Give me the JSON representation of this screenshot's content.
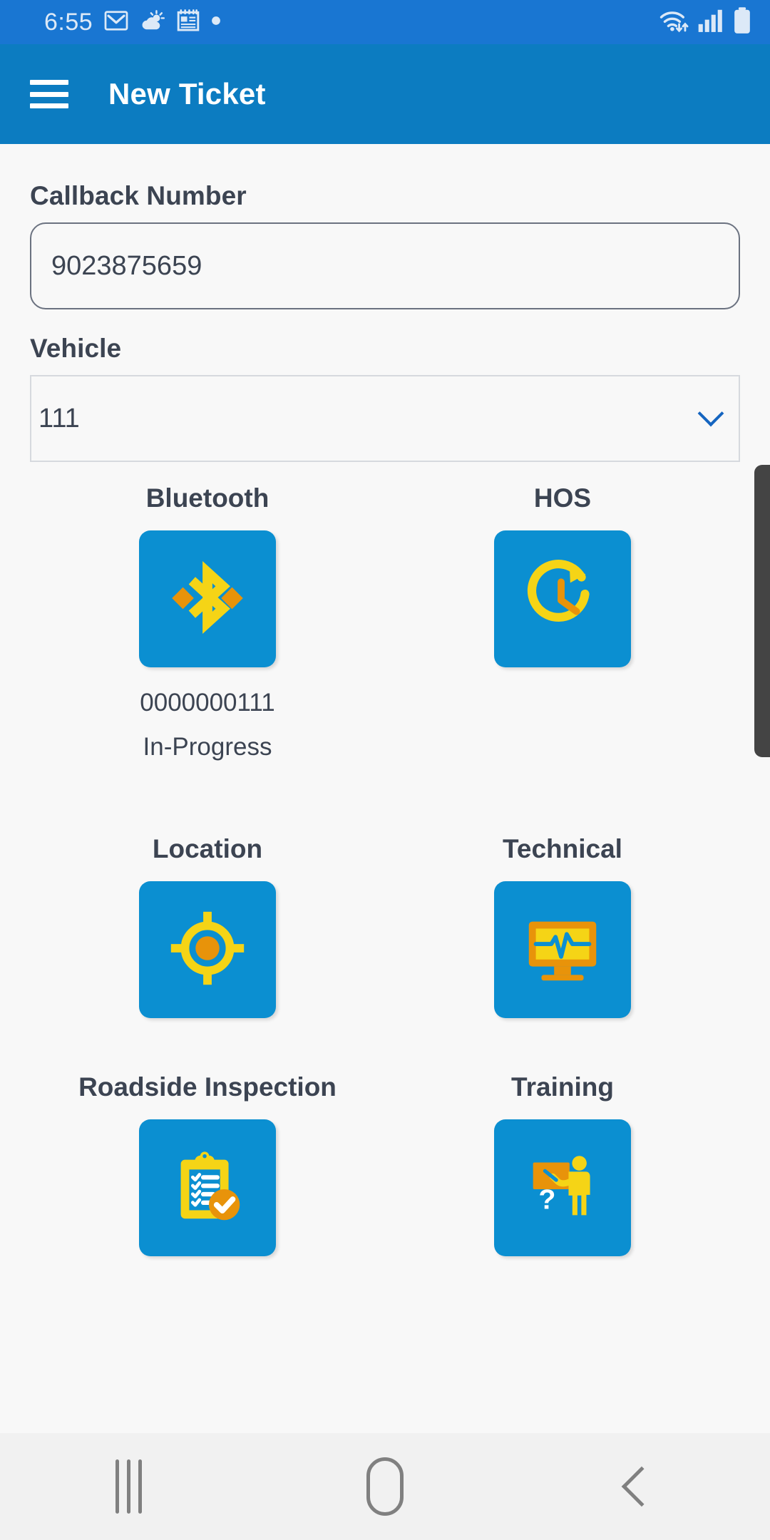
{
  "status_bar": {
    "time": "6:55",
    "left_icons": [
      "gmail-icon",
      "weather-icon",
      "calendar-icon",
      "dot-icon"
    ],
    "right_icons": [
      "wifi-icon",
      "cellular-signal-icon",
      "battery-icon"
    ],
    "background_color": "#1976D2"
  },
  "app_bar": {
    "menu_icon": "hamburger-menu-icon",
    "title": "New Ticket",
    "background_color": "#0C7CC1"
  },
  "form": {
    "callback": {
      "label": "Callback Number",
      "value": "9023875659",
      "placeholder": "Callback Number"
    },
    "vehicle": {
      "label": "Vehicle",
      "value": "111",
      "chevron_icon": "chevron-down-icon"
    }
  },
  "tiles": [
    {
      "label": "Bluetooth",
      "icon": "bluetooth-icon",
      "device_id": "0000000111",
      "status": "In-Progress"
    },
    {
      "label": "HOS",
      "icon": "hours-of-service-clock-icon"
    },
    {
      "label": "Location",
      "icon": "location-crosshair-icon"
    },
    {
      "label": "Technical",
      "icon": "technical-monitor-icon"
    },
    {
      "label": "Roadside Inspection",
      "icon": "clipboard-check-icon"
    },
    {
      "label": "Training",
      "icon": "training-instructor-icon"
    }
  ],
  "colors": {
    "tile_background": "#0B8FD1",
    "icon_yellow": "#F5D416",
    "icon_orange": "#E8930A",
    "label_text": "#3C4452",
    "page_background": "#F8F8F8",
    "accent_blue": "#1565C0"
  },
  "nav_bar": {
    "recents_label": "recents-button",
    "home_label": "home-button",
    "back_label": "back-button"
  }
}
